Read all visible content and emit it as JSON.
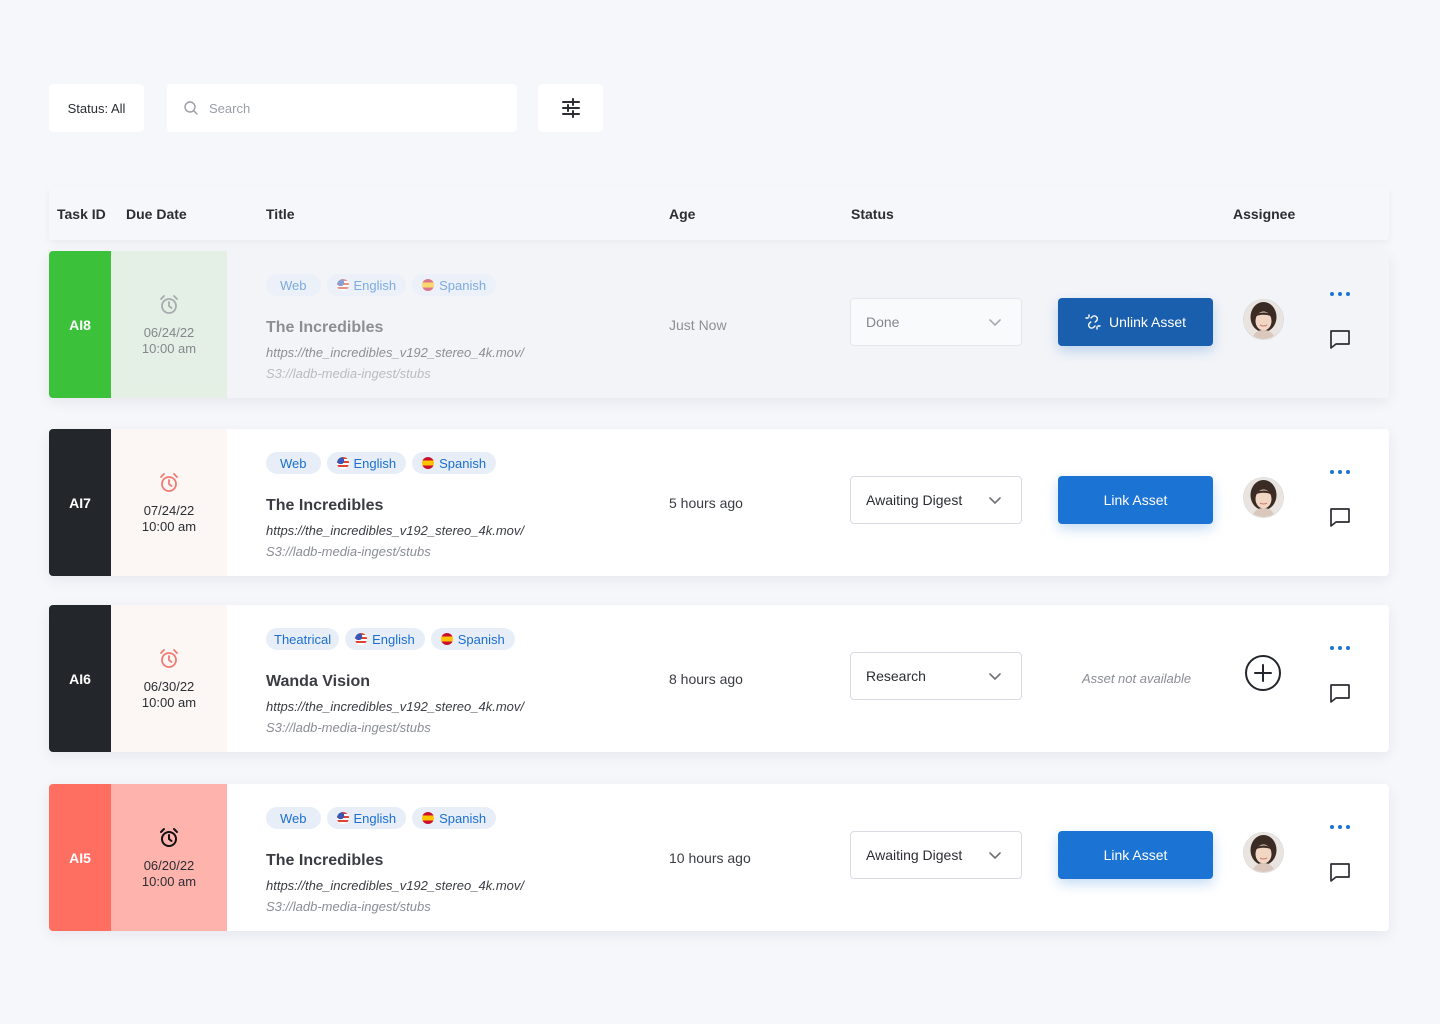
{
  "toolbar": {
    "status_filter_label": "Status: All",
    "search_placeholder": "Search"
  },
  "table": {
    "columns": [
      "Task ID",
      "Due Date",
      "Title",
      "Age",
      "Status",
      "Assignee"
    ]
  },
  "tasks": [
    {
      "id": "AI8",
      "date": "06/24/22",
      "time": "10:00 am",
      "tags": [
        "Web",
        "English",
        "Spanish"
      ],
      "title": "The Incredibles",
      "url": "https://the_incredibles_v192_stereo_4k.mov/",
      "path": "S3://ladb-media-ingest/stubs",
      "age": "Just Now",
      "status": "Done",
      "asset_action": "Unlink Asset",
      "id_color": "#3cc13b",
      "date_bg": "#d9ecd6"
    },
    {
      "id": "AI7",
      "date": "07/24/22",
      "time": "10:00 am",
      "tags": [
        "Web",
        "English",
        "Spanish"
      ],
      "title": "The Incredibles",
      "url": "https://the_incredibles_v192_stereo_4k.mov/",
      "path": "S3://ladb-media-ingest/stubs",
      "age": "5 hours ago",
      "status": "Awaiting Digest",
      "asset_action": "Link Asset",
      "id_color": "#23262b",
      "date_bg": "#fcf6f5"
    },
    {
      "id": "AI6",
      "date": "06/30/22",
      "time": "10:00 am",
      "tags": [
        "Theatrical",
        "English",
        "Spanish"
      ],
      "title": "Wanda Vision",
      "url": "https://the_incredibles_v192_stereo_4k.mov/",
      "path": "S3://ladb-media-ingest/stubs",
      "age": "8 hours ago",
      "status": "Research",
      "asset_note": "Asset not available",
      "id_color": "#23262b",
      "date_bg": "#fcf6f5"
    },
    {
      "id": "AI5",
      "date": "06/20/22",
      "time": "10:00 am",
      "tags": [
        "Web",
        "English",
        "Spanish"
      ],
      "title": "The Incredibles",
      "url": "https://the_incredibles_v192_stereo_4k.mov/",
      "path": "S3://ladb-media-ingest/stubs",
      "age": "10 hours ago",
      "status": "Awaiting Digest",
      "asset_action": "Link Asset",
      "id_color": "#ff6f61",
      "date_bg": "#ffb3ad"
    }
  ],
  "icons": {
    "search": "search-icon",
    "filter": "sliders-icon",
    "clock": "alarm-clock-icon",
    "chevron": "chevron-down-icon",
    "unlink": "unlink-icon",
    "more": "more-dots-icon",
    "comment": "comment-icon",
    "add": "plus-circle-icon"
  },
  "colors": {
    "primary": "#1b73d3",
    "primary_dark": "#1a5fae",
    "done_green": "#3cc13b",
    "overdue_red": "#ff6f61",
    "clock_red": "#f07b72"
  }
}
